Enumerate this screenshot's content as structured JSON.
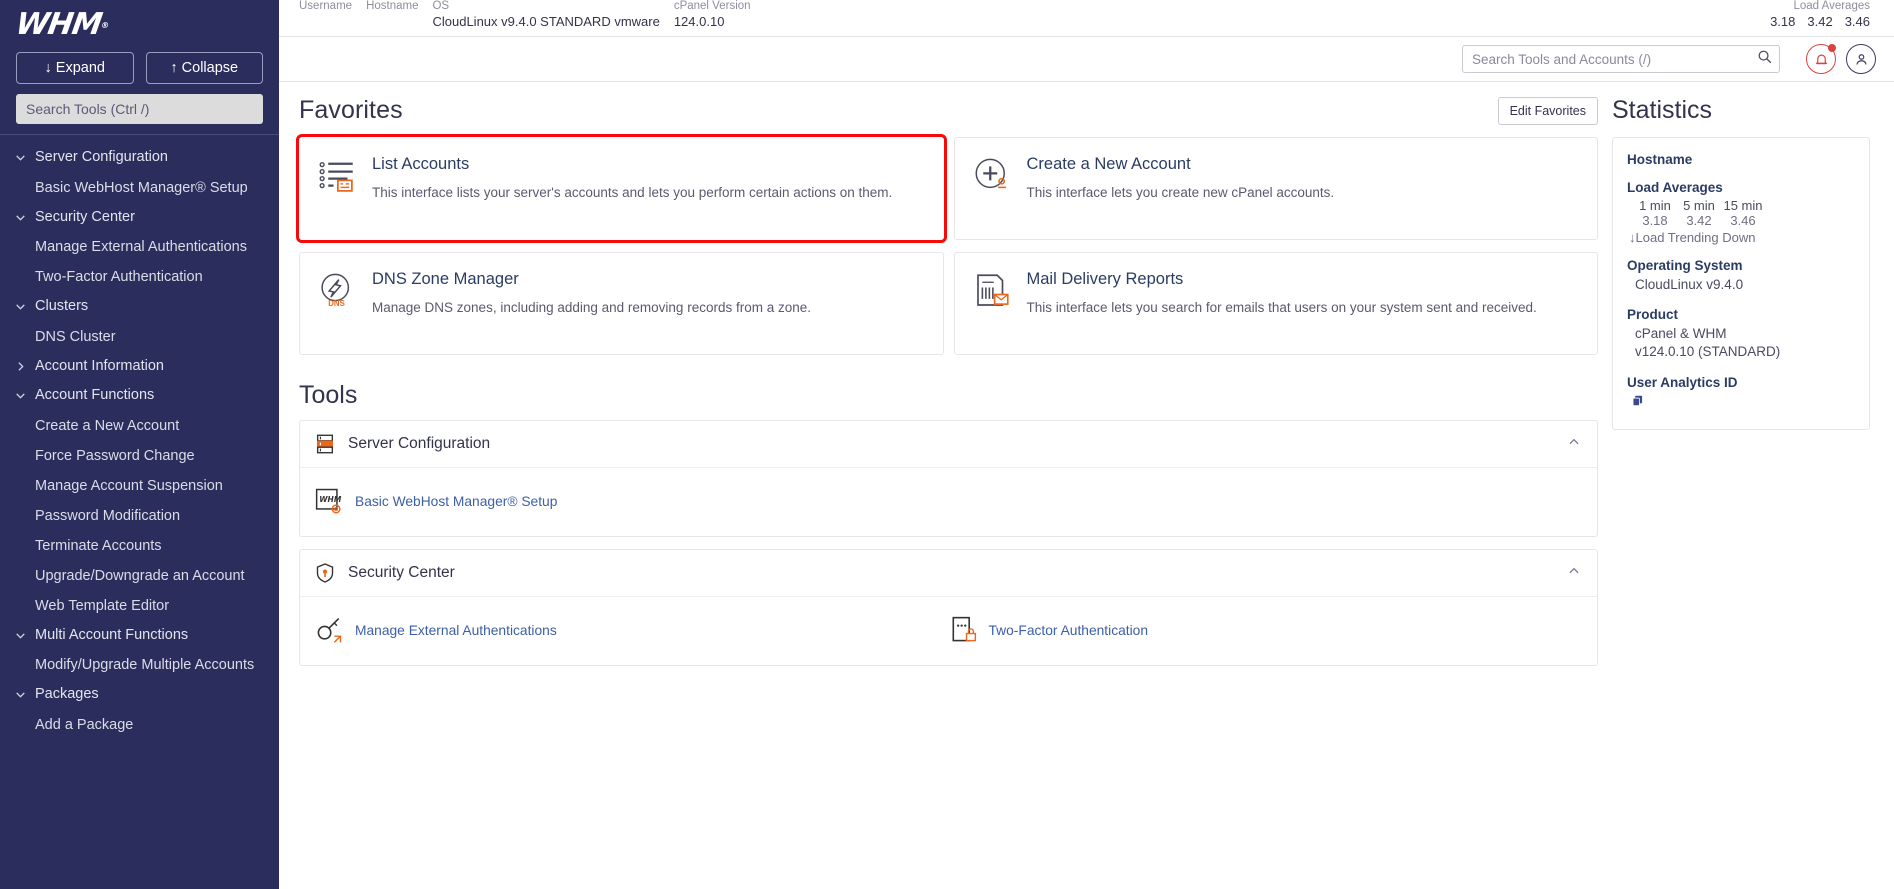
{
  "sidebar": {
    "logo": "WHM",
    "expand_label": "Expand",
    "collapse_label": "Collapse",
    "search_placeholder": "Search Tools (Ctrl /)",
    "nav": [
      {
        "label": "Server Configuration",
        "type": "group",
        "icon": "chevron-down-icon"
      },
      {
        "label": "Basic WebHost Manager® Setup",
        "type": "item"
      },
      {
        "label": "Security Center",
        "type": "group",
        "icon": "chevron-down-icon"
      },
      {
        "label": "Manage External Authentications",
        "type": "item"
      },
      {
        "label": "Two-Factor Authentication",
        "type": "item"
      },
      {
        "label": "Clusters",
        "type": "group",
        "icon": "chevron-down-icon"
      },
      {
        "label": "DNS Cluster",
        "type": "item"
      },
      {
        "label": "Account Information",
        "type": "group",
        "icon": "chevron-right-icon"
      },
      {
        "label": "Account Functions",
        "type": "group",
        "icon": "chevron-down-icon"
      },
      {
        "label": "Create a New Account",
        "type": "item"
      },
      {
        "label": "Force Password Change",
        "type": "item"
      },
      {
        "label": "Manage Account Suspension",
        "type": "item"
      },
      {
        "label": "Password Modification",
        "type": "item"
      },
      {
        "label": "Terminate Accounts",
        "type": "item"
      },
      {
        "label": "Upgrade/Downgrade an Account",
        "type": "item"
      },
      {
        "label": "Web Template Editor",
        "type": "item"
      },
      {
        "label": "Multi Account Functions",
        "type": "group",
        "icon": "chevron-down-icon"
      },
      {
        "label": "Modify/Upgrade Multiple Accounts",
        "type": "item"
      },
      {
        "label": "Packages",
        "type": "group",
        "icon": "chevron-down-icon"
      },
      {
        "label": "Add a Package",
        "type": "item"
      }
    ]
  },
  "topinfo": {
    "columns": [
      {
        "label": "Username",
        "value": ""
      },
      {
        "label": "Hostname",
        "value": ""
      },
      {
        "label": "OS",
        "value": "CloudLinux v9.4.0 STANDARD vmware"
      },
      {
        "label": "cPanel Version",
        "value": "124.0.10"
      }
    ],
    "load_label": "Load Averages",
    "load_values": [
      "3.18",
      "3.42",
      "3.46"
    ]
  },
  "topbar": {
    "search_placeholder": "Search Tools and Accounts (/)",
    "search_value": "",
    "notifications_icon": "bell-icon",
    "user_icon": "user-icon"
  },
  "favorites": {
    "title": "Favorites",
    "edit_label": "Edit Favorites",
    "cards": [
      {
        "title": "List Accounts",
        "desc": "This interface lists your server's accounts and lets you perform certain actions on them.",
        "icon": "list-accounts-icon",
        "highlighted": true
      },
      {
        "title": "Create a New Account",
        "desc": "This interface lets you create new cPanel accounts.",
        "icon": "plus-circle-icon",
        "highlighted": false
      },
      {
        "title": "DNS Zone Manager",
        "desc": "Manage DNS zones, including adding and removing records from a zone.",
        "icon": "dns-icon",
        "highlighted": false
      },
      {
        "title": "Mail Delivery Reports",
        "desc": "This interface lets you search for emails that users on your system sent and received.",
        "icon": "mail-report-icon",
        "highlighted": false
      }
    ]
  },
  "statistics": {
    "title": "Statistics",
    "hostname_label": "Hostname",
    "hostname_value": "",
    "load_label": "Load Averages",
    "load_headers": [
      "1 min",
      "5 min",
      "15 min"
    ],
    "load_values": [
      "3.18",
      "3.42",
      "3.46"
    ],
    "trend": "↓Load Trending Down",
    "os_label": "Operating System",
    "os_value": "CloudLinux v9.4.0",
    "product_label": "Product",
    "product_value": "cPanel & WHM v124.0.10 (STANDARD)",
    "analytics_label": "User Analytics ID",
    "analytics_icon": "copy-icon"
  },
  "tools": {
    "title": "Tools",
    "sections": [
      {
        "name": "Server Configuration",
        "icon": "server-config-icon",
        "chevron": "chevron-up-icon",
        "links": [
          {
            "label": "Basic WebHost Manager® Setup",
            "icon": "whm-setup-icon"
          }
        ]
      },
      {
        "name": "Security Center",
        "icon": "shield-icon",
        "chevron": "chevron-up-icon",
        "links": [
          {
            "label": "Manage External Authentications",
            "icon": "key-icon"
          },
          {
            "label": "Two-Factor Authentication",
            "icon": "two-factor-icon"
          }
        ]
      }
    ]
  },
  "colors": {
    "sidebar_bg": "#2b2d5c",
    "accent_orange": "#ec671b",
    "link_blue": "#3c5fa8",
    "highlight_red": "#f60a0a",
    "alert_red": "#d9433f"
  }
}
